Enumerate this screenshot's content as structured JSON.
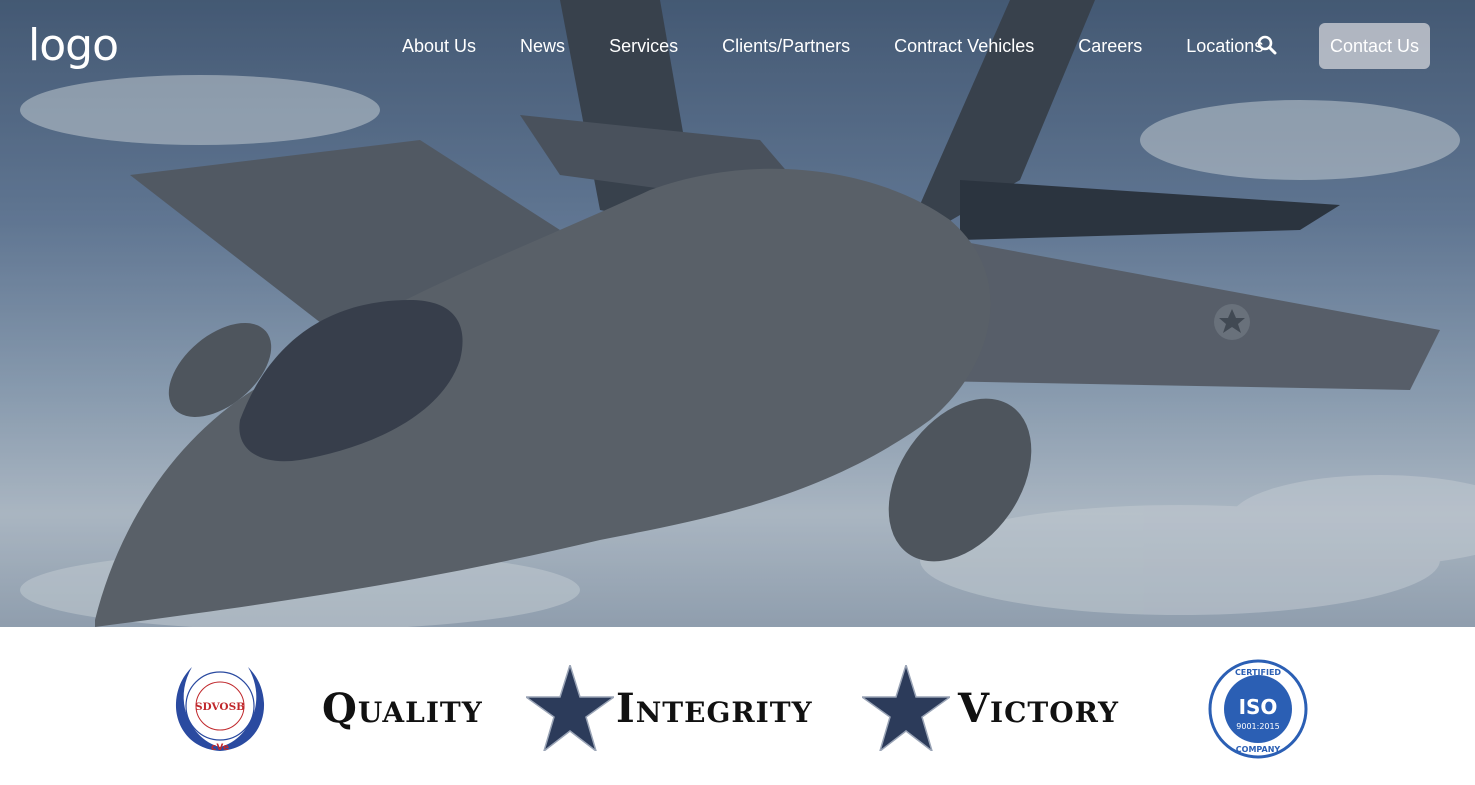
{
  "header": {
    "logo_text": "logo",
    "nav_items": [
      "About Us",
      "News",
      "Services",
      "Clients/Partners",
      "Contract Vehicles",
      "Careers",
      "Locations"
    ],
    "search_icon": "search-icon",
    "contact_label": "Contact Us"
  },
  "hero": {
    "image_description_icon": "fighter-jet-image"
  },
  "badges": {
    "sdvosb": {
      "center": "SDVOSB",
      "ring": "Service Disabled Veteran Owned Small Business",
      "bottom": "cVe"
    },
    "motto": [
      "Quality",
      "Integrity",
      "Victory"
    ],
    "iso": {
      "top": "CERTIFIED",
      "center": "ISO",
      "standard": "9001:2015",
      "bottom": "COMPANY"
    }
  },
  "colors": {
    "sky_dark": "#4d6381",
    "sky_light": "#c9d4e0",
    "contact_button": "#cdd0d6",
    "sdvosb_blue": "#2a4aa0",
    "sdvosb_red": "#c0282c",
    "iso_blue": "#2b5fb4",
    "motto_star": "#2c3b5a"
  }
}
